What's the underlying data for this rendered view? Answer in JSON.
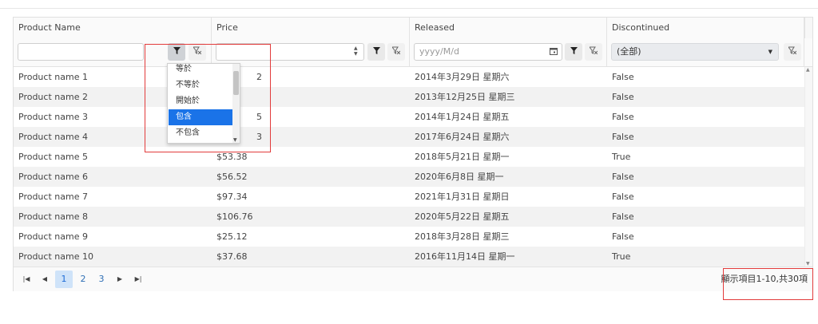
{
  "columns": [
    "Product Name",
    "Price",
    "Released",
    "Discontinued"
  ],
  "filters": {
    "name_value": "",
    "price_value": "",
    "released_placeholder": "yyyy/M/d",
    "discontinued_value": "(全部)"
  },
  "operator_dropdown": {
    "options": [
      "等於",
      "不等於",
      "開始於",
      "包含",
      "不包含"
    ],
    "selected": "包含"
  },
  "rows": [
    {
      "name": "Product name 1",
      "price": "$",
      "released": "2014年3月29日 星期六",
      "discontinued": "False"
    },
    {
      "name": "Product name 2",
      "price": "",
      "released": "2013年12月25日 星期三",
      "discontinued": "False"
    },
    {
      "name": "Product name 3",
      "price": "",
      "released": "2014年1月24日 星期五",
      "discontinued": "False"
    },
    {
      "name": "Product name 4",
      "price": "",
      "released": "2017年6月24日 星期六",
      "discontinued": "False"
    },
    {
      "name": "Product name 5",
      "price": "$53.38",
      "released": "2018年5月21日 星期一",
      "discontinued": "True"
    },
    {
      "name": "Product name 6",
      "price": "$56.52",
      "released": "2020年6月8日 星期一",
      "discontinued": "False"
    },
    {
      "name": "Product name 7",
      "price": "$97.34",
      "released": "2021年1月31日 星期日",
      "discontinued": "False"
    },
    {
      "name": "Product name 8",
      "price": "$106.76",
      "released": "2020年5月22日 星期五",
      "discontinued": "False"
    },
    {
      "name": "Product name 9",
      "price": "$25.12",
      "released": "2018年3月28日 星期三",
      "discontinued": "False"
    },
    {
      "name": "Product name 10",
      "price": "$37.68",
      "released": "2016年11月14日 星期一",
      "discontinued": "True"
    }
  ],
  "partial_price_fragments": [
    "2",
    "5",
    "3"
  ],
  "pager": {
    "pages": [
      "1",
      "2",
      "3"
    ],
    "current": "1",
    "info": "顯示項目1-10,共30項"
  },
  "icons": {
    "filter": "filter-funnel-icon",
    "clear_filter": "clear-filter-icon",
    "calendar": "calendar-icon",
    "first": "first-page-icon",
    "prev": "prev-page-icon",
    "next": "next-page-icon",
    "last": "last-page-icon"
  },
  "colors": {
    "selected_option": "#1a73e8",
    "highlight_box": "#e23b3b",
    "current_page_bg": "#cfe3f9"
  }
}
